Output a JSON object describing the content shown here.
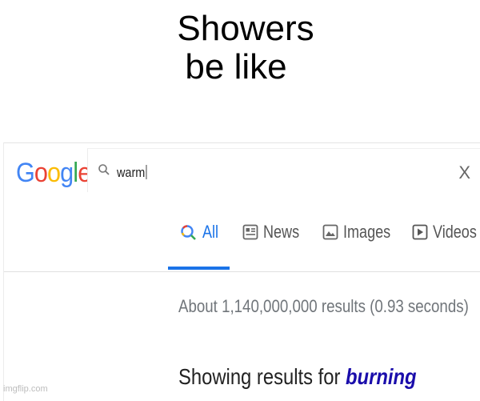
{
  "caption": {
    "line1": "Showers",
    "line2": "be like"
  },
  "logo": {
    "letters": [
      {
        "ch": "G",
        "color": "#4285f4"
      },
      {
        "ch": "o",
        "color": "#ea4335"
      },
      {
        "ch": "o",
        "color": "#fbbc05"
      },
      {
        "ch": "g",
        "color": "#4285f4"
      },
      {
        "ch": "l",
        "color": "#34a853"
      },
      {
        "ch": "e",
        "color": "#ea4335"
      }
    ]
  },
  "search": {
    "query": "warm",
    "clear_symbol": "X"
  },
  "tabs": [
    {
      "label": "All",
      "icon": "search-icon",
      "active": true
    },
    {
      "label": "News",
      "icon": "news-icon",
      "active": false
    },
    {
      "label": "Images",
      "icon": "images-icon",
      "active": false
    },
    {
      "label": "Videos",
      "icon": "videos-icon",
      "active": false
    }
  ],
  "results": {
    "stats": "About 1,140,000,000 results (0.93 seconds)",
    "correction_prefix": "Showing results for",
    "correction_term": "burning"
  },
  "watermark": "imgflip.com",
  "colors": {
    "accent": "#1a73e8",
    "link": "#1a0dab"
  }
}
